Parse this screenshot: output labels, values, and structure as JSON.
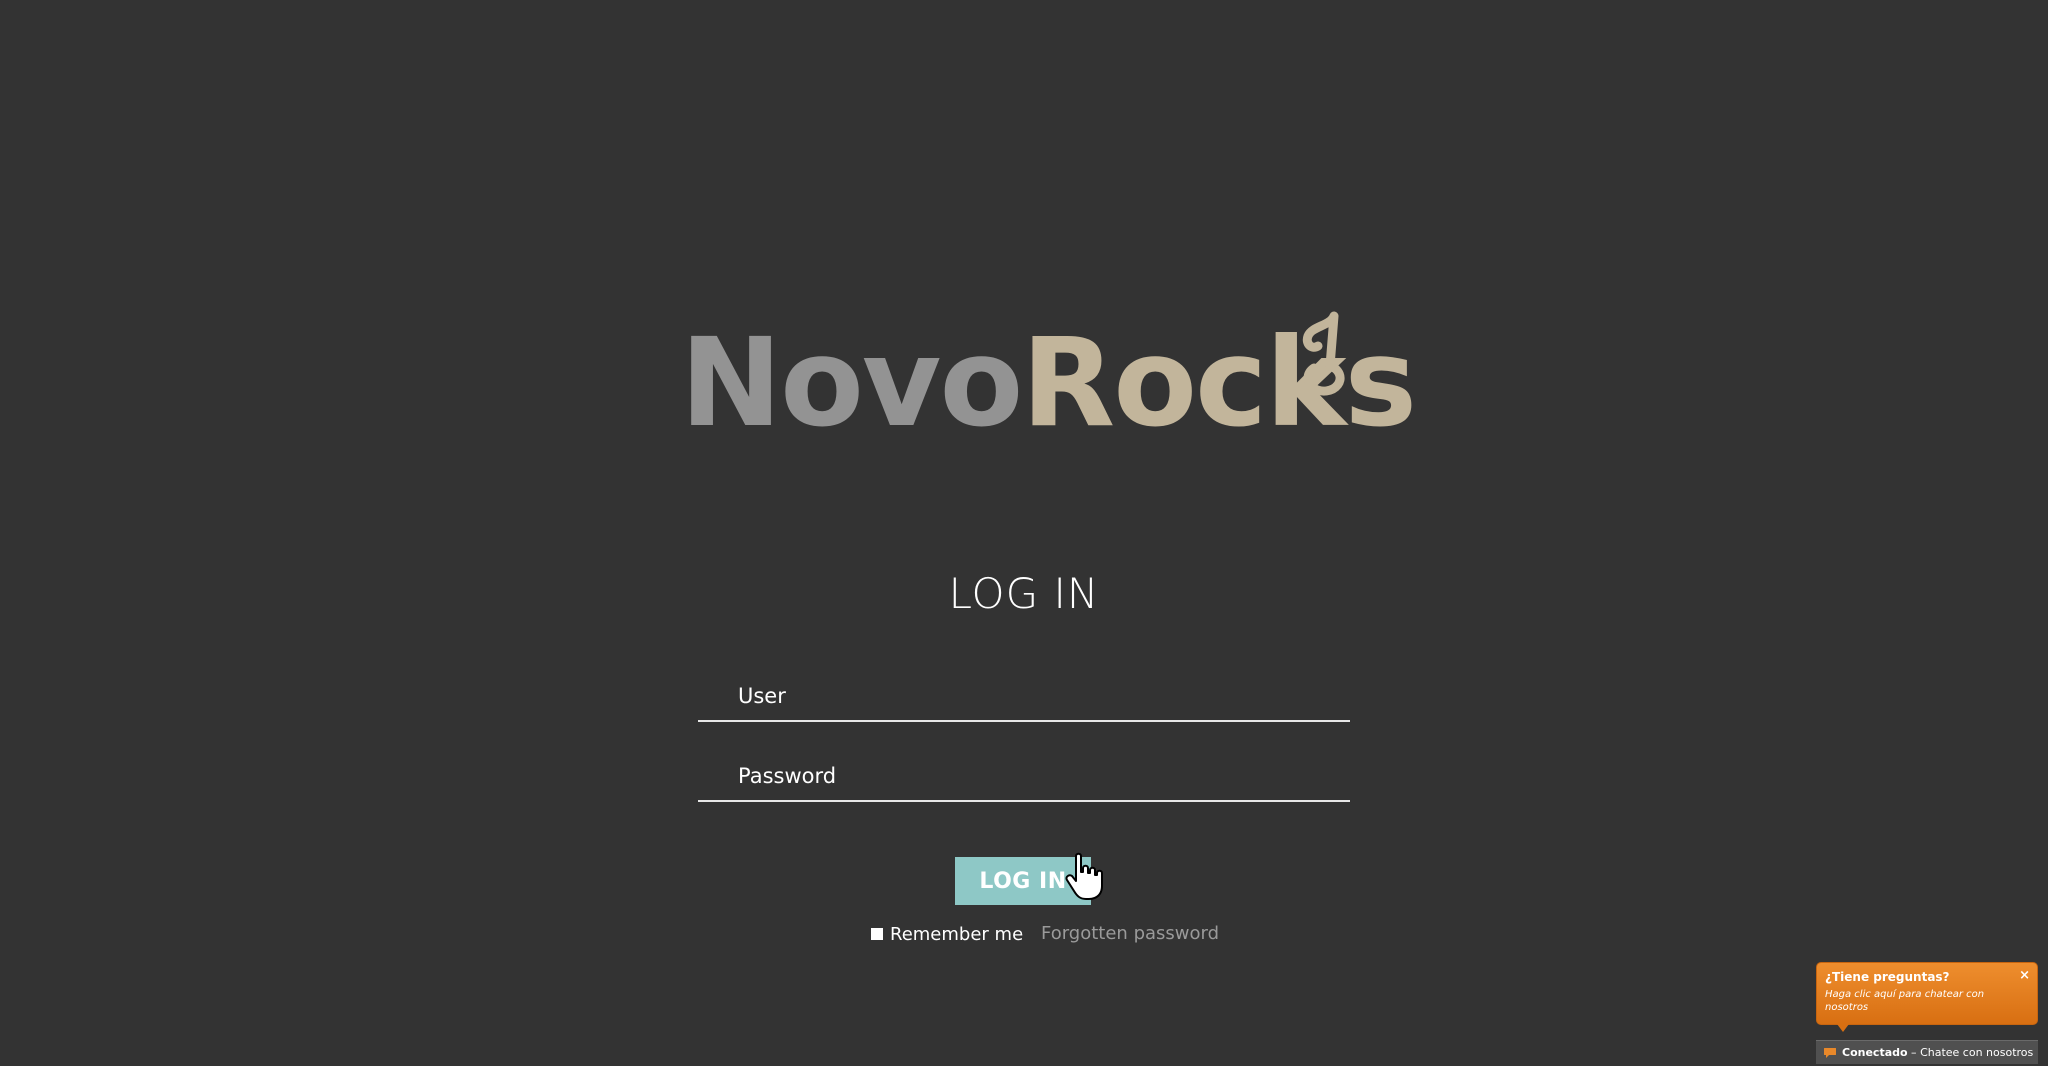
{
  "logo": {
    "part1": "Novo",
    "part2": "Rocks",
    "icon": "music-note-icon",
    "colors": {
      "part1": "#939393",
      "part2": "#c2b59b"
    }
  },
  "login": {
    "title": "LOG IN",
    "user_placeholder": "User",
    "password_placeholder": "Password",
    "button_label": "LOG IN",
    "remember_label": "Remember me",
    "forgot_label": "Forgotten password"
  },
  "chat": {
    "title": "¿Tiene preguntas?",
    "close": "×",
    "subtitle": "Haga clic aquí para chatear con nosotros",
    "status": "Conectado",
    "separator": " – ",
    "cta": "Chatee con nosotros",
    "icon": "chat-bubble-icon"
  },
  "colors": {
    "background": "#333333",
    "button": "#8ec8c6",
    "chat": "#e07a1c",
    "link": "#9a9a9a"
  }
}
